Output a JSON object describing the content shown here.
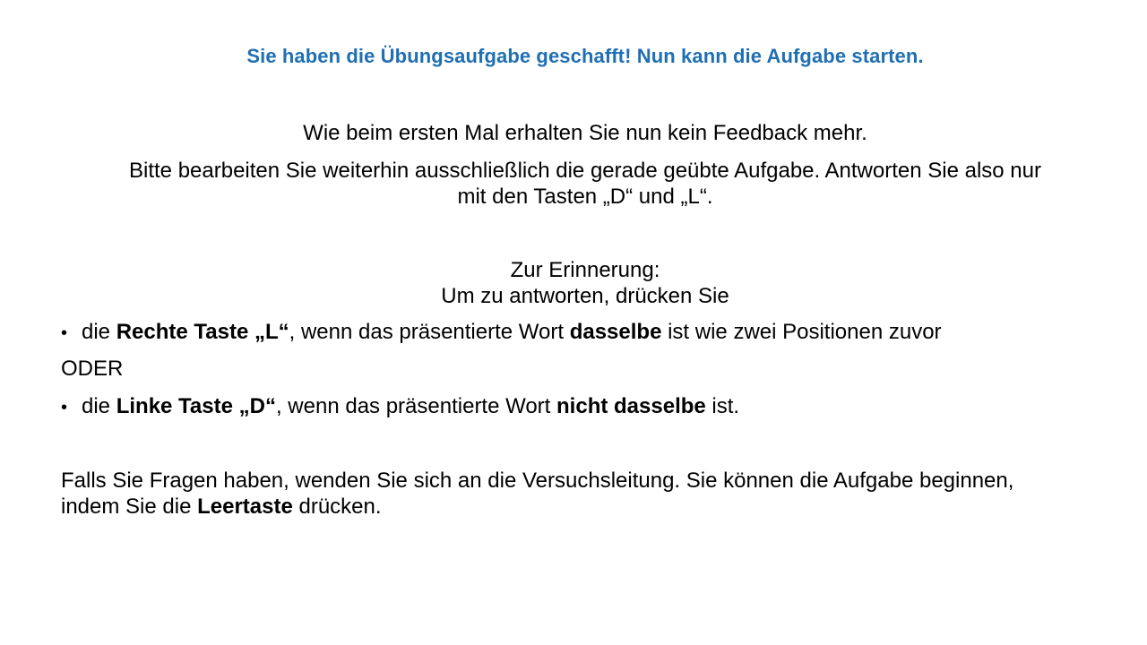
{
  "title": "Sie haben die Übungsaufgabe geschafft! Nun kann die Aufgabe starten.",
  "feedback_line": "Wie beim ersten Mal erhalten Sie nun kein Feedback mehr.",
  "bitte_line_1": "Bitte bearbeiten Sie weiterhin ausschließlich die gerade geübte Aufgabe. Antworten Sie also nur",
  "bitte_line_2": "mit den Tasten „D“ und „L“.",
  "reminder_heading": "Zur Erinnerung:",
  "reminder_sub": "Um zu antworten, drücken Sie",
  "bullet_symbol": "•",
  "right_key": {
    "prefix": "die ",
    "key": "Rechte Taste „L“",
    "middle": ", wenn das präsentierte Wort ",
    "emphasis": "dasselbe",
    "suffix": " ist wie zwei Positionen zuvor"
  },
  "oder": "ODER",
  "left_key": {
    "prefix": "die ",
    "key": "Linke Taste „D“",
    "middle": ", wenn das präsentierte Wort ",
    "emphasis": "nicht dasselbe",
    "suffix": " ist."
  },
  "falls_line_1": "Falls Sie Fragen haben, wenden Sie sich an die Versuchsleitung. Sie können die Aufgabe beginnen,",
  "falls_line_2_prefix": "indem Sie die ",
  "falls_line_2_key": "Leertaste",
  "falls_line_2_suffix": " drücken.",
  "colors": {
    "title": "#1f6fb2",
    "text": "#000000",
    "background": "#ffffff"
  }
}
